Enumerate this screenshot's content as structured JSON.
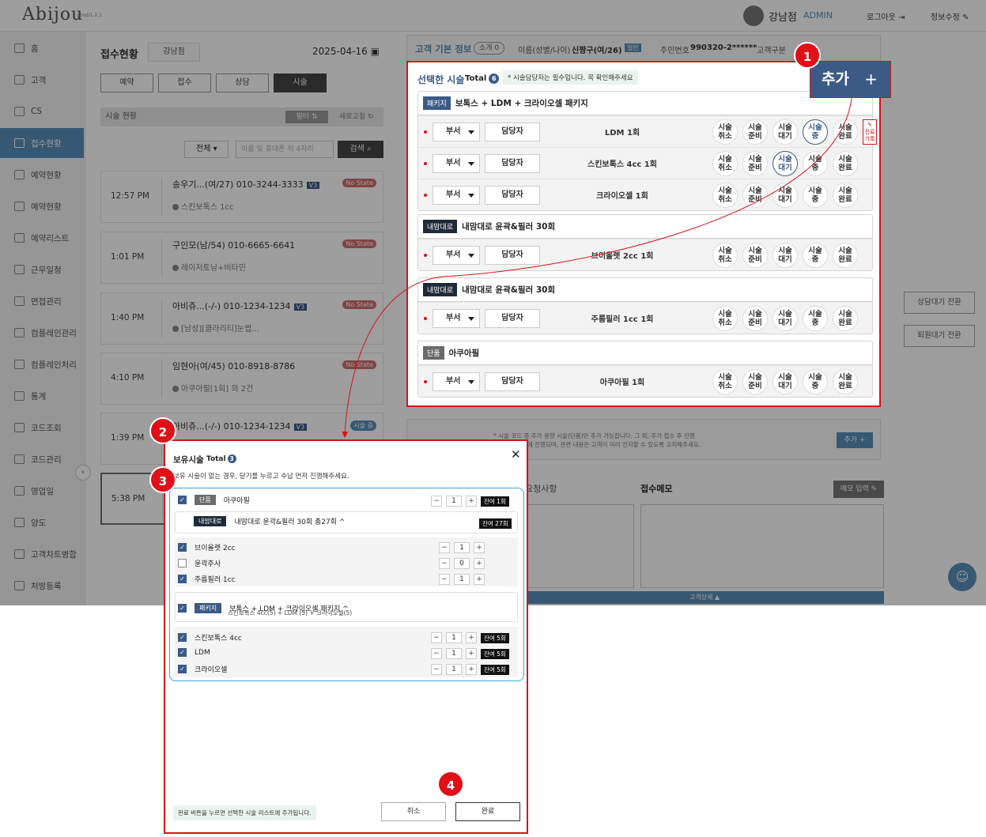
{
  "app": {
    "logo": "Abijou",
    "version": "prod/1.2.1",
    "user": "강남점",
    "role": "ADMIN",
    "logout": "로그아웃",
    "edit_info": "정보수정"
  },
  "sidebar": [
    "홈",
    "고객",
    "CS",
    "접수현황",
    "예약현황",
    "예약현황",
    "예약리스트",
    "근무일정",
    "면접관리",
    "컴플레인관리",
    "컴플레인처리",
    "통계",
    "코드조회",
    "코드관리",
    "영업일",
    "양도",
    "고객차트병합",
    "처방등록"
  ],
  "left": {
    "title": "접수현황",
    "branch": "강남점",
    "date": "2025-04-16",
    "tabs": [
      "예약",
      "접수",
      "상담",
      "시술"
    ],
    "section": "시술 현황",
    "filter": "필터",
    "refresh": "새로고침",
    "select": "전체",
    "search_placeholder": "이름 및 휴대폰 뒤 4자리",
    "search_btn": "검색",
    "cards": [
      {
        "time": "12:57 PM",
        "name": "송우기...(여/27) 010-3244-3333",
        "v3": "V3",
        "status": "No State",
        "sub": "스킨보톡스 1cc"
      },
      {
        "time": "1:01 PM",
        "name": "구인모(남/54) 010-6665-6641",
        "v3": "",
        "status": "No State",
        "sub": "레이저토닝+비타민"
      },
      {
        "time": "1:40 PM",
        "name": "아비쥬...(-/-) 010-1234-1234",
        "v3": "V3",
        "status": "No State",
        "sub": "[남성][클라리티]눈썹..."
      },
      {
        "time": "4:10 PM",
        "name": "임현아(여/45) 010-8918-8786",
        "v3": "",
        "status": "No State",
        "sub": "아쿠아필[1회] 외 2건"
      },
      {
        "time": "1:39 PM",
        "name": "아비쥬...(-/-) 010-1234-1234",
        "v3": "V3",
        "status": "시술 중",
        "sub": ""
      },
      {
        "time": "5:38 PM",
        "name": "",
        "v3": "",
        "status": "",
        "sub": ""
      }
    ]
  },
  "customer": {
    "title": "고객 기본 정보",
    "intro": "소개 0",
    "name_label": "이름(성별/나이)",
    "name": "신짱구(여/26)",
    "grade": "일반",
    "rrn_label": "주민번호",
    "rrn": "990320-2******",
    "type_label": "고객구분"
  },
  "selected": {
    "title": "선택한 시술",
    "total_label": "Total",
    "total": "6",
    "note": "* 시술담당자는 필수입니다. 꼭 확인해주세요",
    "add": "추가",
    "dept": "부서",
    "mgr": "담당자",
    "memo": "진료 기록",
    "statuses": [
      "시술 취소",
      "시술 준비",
      "시술 대기",
      "시술 중",
      "시술 완료"
    ],
    "groups": [
      {
        "tag": "패키지",
        "name": "보톡스 + LDM + 크라이오셀 패키지",
        "rows": [
          {
            "proc": "LDM 1회",
            "active": 3
          },
          {
            "proc": "스킨보톡스 4cc 1회",
            "active": 2
          },
          {
            "proc": "크라이오셀 1회",
            "active": -1
          }
        ]
      },
      {
        "tag": "내맘대로",
        "name": "내맘대로 윤곽&필러 30회",
        "rows": [
          {
            "proc": "브이올렛 2cc 1회",
            "active": -1
          }
        ]
      },
      {
        "tag": "내맘대로",
        "name": "내맘대로 윤곽&필러 30회",
        "rows": [
          {
            "proc": "주름필러 1cc 1회",
            "active": -1
          }
        ]
      },
      {
        "tag": "단품",
        "name": "아쿠아필",
        "rows": [
          {
            "proc": "아쿠아필 1회",
            "active": -1
          }
        ]
      }
    ]
  },
  "below": {
    "add_note": "* 시술 코드 중 추가 용량 시술(단품)만 추가 가능합니다. 그 외, 추가 접수 후 진행\n접수(회원) 시에 진행되며, 관련 내용은 고객이 미리 인지할 수 있도록 고지해주세요.",
    "add_btn": "추가 +",
    "req_tab": "요청사항",
    "memo_tab": "접수메모",
    "memo_btn": "메모 입력",
    "cust_detail": "고객상세 ▲",
    "side_btn1": "상담대기 전환",
    "side_btn2": "퇴원대기 전환"
  },
  "modal": {
    "title": "보유시술",
    "total_label": "Total",
    "total": "3",
    "instruction": "보유 시술이 없는 경우, 닫기를 누르고 수납 먼저 진행해주세요.",
    "hint": "완료 버튼을 누르면 선택한 시술 리스트에 추가됩니다.",
    "cancel": "취소",
    "done": "완료",
    "items": [
      {
        "tag": "단품",
        "name": "아쿠아필",
        "checked": true,
        "qty": "1",
        "remain": "잔여 1회"
      },
      {
        "tag": "내맘대로",
        "name": "내맘대로 윤곽&필러 30회 총27회 ^",
        "remain": "잔여 27회"
      },
      {
        "name": "브이올렛 2cc",
        "checked": true,
        "qty": "1"
      },
      {
        "name": "윤곽주사",
        "checked": false,
        "qty": "0"
      },
      {
        "name": "주름필러 1cc",
        "checked": true,
        "qty": "1"
      },
      {
        "tag": "패키지",
        "name": "보톡스 + LDM + 크라이오셀 패키지 ^",
        "desc": "스킨보톡스 4cc(5) + LDM (5) + 크라이오셀(5)",
        "checked": true
      },
      {
        "name": "스킨보톡스 4cc",
        "checked": true,
        "qty": "1",
        "remain": "잔여 5회"
      },
      {
        "name": "LDM",
        "checked": true,
        "qty": "1",
        "remain": "잔여 5회"
      },
      {
        "name": "크라이오셀",
        "checked": true,
        "qty": "1",
        "remain": "잔여 5회"
      }
    ]
  },
  "steps": [
    "1",
    "2",
    "3",
    "4"
  ]
}
